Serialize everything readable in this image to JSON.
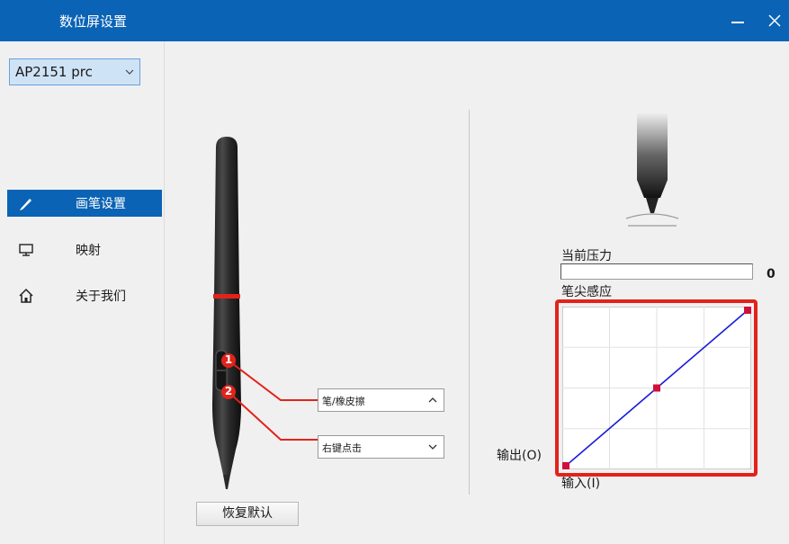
{
  "window": {
    "title": "数位屏设置",
    "minimize_icon": "minimize-icon",
    "close_icon": "close-icon",
    "title_bar_color": "#0a63b4"
  },
  "sidebar": {
    "device_select": {
      "value": "AP2151 prc"
    },
    "items": [
      {
        "label": "画笔设置",
        "icon": "pen-icon",
        "active": true
      },
      {
        "label": "映射",
        "icon": "monitor-icon",
        "active": false
      },
      {
        "label": "关于我们",
        "icon": "home-icon",
        "active": false
      }
    ]
  },
  "pen_buttons": {
    "button1": {
      "number": "1",
      "value": "笔/橡皮擦"
    },
    "button2": {
      "number": "2",
      "value": "右键点击"
    },
    "accent_color": "#e2231a"
  },
  "restore_button": {
    "label": "恢复默认"
  },
  "pressure": {
    "current_label": "当前压力",
    "current_value": "0",
    "sensitivity_label": "笔尖感应",
    "output_label": "输出(O)",
    "input_label": "输入(I)",
    "curve_line_color": "#1a1adc",
    "curve_point_color": "#d0103a"
  },
  "chart_data": {
    "type": "line",
    "series": [
      {
        "x": [
          0,
          0.5,
          1
        ],
        "y": [
          0,
          0.5,
          1
        ]
      }
    ],
    "xlim": [
      0,
      1
    ],
    "ylim": [
      0,
      1
    ],
    "grid": true
  }
}
